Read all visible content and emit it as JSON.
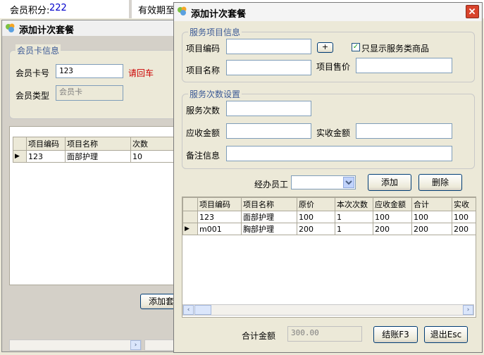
{
  "top_bar": {
    "points_label": "会员积分:",
    "points_value": "222",
    "valid_label": "有效期至"
  },
  "back_window": {
    "title": "添加计次套餐",
    "card_group_title": "会员卡信息",
    "card_no_label": "会员卡号",
    "card_no_value": "123",
    "enter_hint": "请回车",
    "member_type_label": "会员类型",
    "member_type_value": "会员卡",
    "columns": [
      "项目编码",
      "项目名称",
      "次数"
    ],
    "rows": [
      [
        "123",
        "面部护理",
        "10"
      ]
    ],
    "add_button": "添加套"
  },
  "dialog": {
    "title": "添加计次套餐",
    "service_group_title": "服务项目信息",
    "item_code_label": "项目编码",
    "item_code_value": "",
    "plus_button": "+",
    "only_service_label": "只显示服务类商品",
    "only_service_checked": true,
    "item_name_label": "项目名称",
    "item_name_value": "",
    "item_price_label": "项目售价",
    "item_price_value": "",
    "count_group_title": "服务次数设置",
    "service_count_label": "服务次数",
    "receivable_label": "应收金额",
    "actual_label": "实收金额",
    "remark_label": "备注信息",
    "staff_label": "经办员工",
    "staff_value": "",
    "add_button": "添加",
    "delete_button": "删除",
    "columns": [
      "项目编码",
      "项目名称",
      "原价",
      "本次次数",
      "应收金额",
      "合计",
      "实收"
    ],
    "rows": [
      [
        "123",
        "面部护理",
        "100",
        "1",
        "100",
        "100",
        "100"
      ],
      [
        "m001",
        "胸部护理",
        "200",
        "1",
        "200",
        "200",
        "200"
      ]
    ],
    "selected_row": 1,
    "total_label": "合计金额",
    "total_value": "300.00",
    "checkout_button": "结账F3",
    "exit_button": "退出Esc"
  },
  "colors": {
    "group_title": "#3c5a96",
    "hint_red": "#cc0000",
    "points_blue": "#0000cc",
    "close_red": "#d8432c"
  }
}
